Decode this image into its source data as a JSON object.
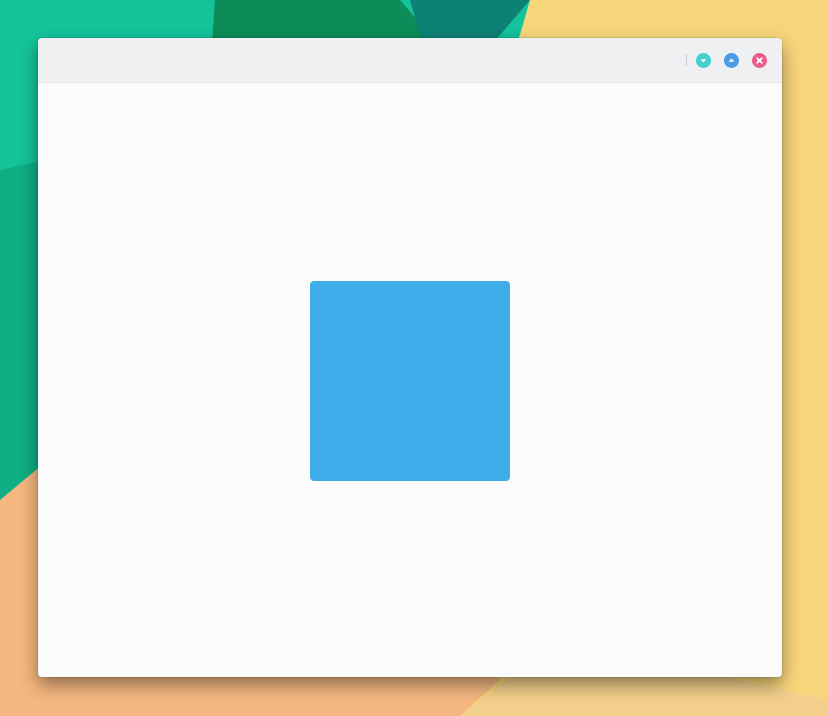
{
  "window": {
    "title": "",
    "buttons": {
      "minimize": {
        "icon": "chevron-down-icon",
        "color": "#42d0d1"
      },
      "maximize": {
        "icon": "chevron-up-icon",
        "color": "#4a9de5"
      },
      "close": {
        "icon": "close-icon",
        "color": "#ec5d8e"
      }
    }
  },
  "content": {
    "shape": {
      "name": "blue-square",
      "color": "#3eadea"
    }
  },
  "wallpaper": {
    "colors": {
      "teal": "#14c39a",
      "dark_green": "#0c8c59",
      "deep_teal": "#0e8175",
      "yellow": "#f7d57b",
      "peach": "#f5b781"
    }
  }
}
